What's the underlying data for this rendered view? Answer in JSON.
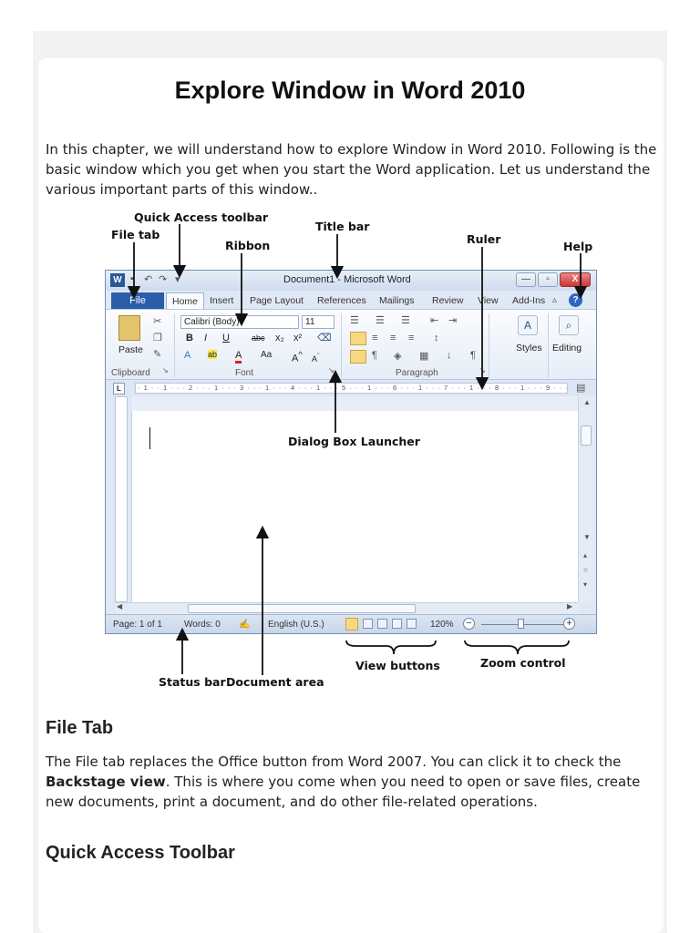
{
  "article": {
    "title": "Explore Window in Word 2010",
    "intro": "In this chapter, we will understand how to explore Window in Word 2010. Following is the basic window which you get when you start the Word application. Let us understand the various important parts of this window..",
    "sections": [
      {
        "heading": "File Tab",
        "text_before": "The File tab replaces the Office button from Word 2007. You can click it to check the ",
        "bold": "Backstage view",
        "text_after": ". This is where you come when you need to open or save files, create new documents, print a document, and do other file-related operations."
      },
      {
        "heading": "Quick Access Toolbar"
      }
    ]
  },
  "figure": {
    "callouts": {
      "quick_access_toolbar": "Quick Access toolbar",
      "file_tab": "File tab",
      "ribbon": "Ribbon",
      "title_bar": "Title bar",
      "ruler": "Ruler",
      "help": "Help",
      "dialog_box_launcher": "Dialog Box Launcher",
      "view_buttons": "View buttons",
      "zoom_control": "Zoom control",
      "status_bar": "Status bar",
      "document_area": "Document area"
    },
    "word_window": {
      "window_title": "Document1 - Microsoft Word",
      "app_icon_letter": "W",
      "file_tab": "File",
      "tabs": [
        "Home",
        "Insert",
        "Page Layout",
        "References",
        "Mailings",
        "Review",
        "View",
        "Add-Ins"
      ],
      "help_symbol": "?",
      "minimize": "—",
      "restore": "▫",
      "close": "X",
      "font_name": "Calibri (Body)",
      "font_size": "11",
      "paste_label": "Paste",
      "groups": [
        "Clipboard",
        "Font",
        "Paragraph"
      ],
      "styles_label": "Styles",
      "editing_label": "Editing",
      "format_buttons": [
        "B",
        "I",
        "U",
        "abc",
        "x₂",
        "x²"
      ],
      "ruler_marks": "· 1 · · 1 · · · 2 · · · 1 · · · 3 · · · 1 · · · 4 · · · 1 · · · 5 · · · 1 · · · 6 · · · 1 · · · 7 · · · 1 · · · 8 · · · 1 · · · 9 · · · 1 · · · 10 · · · 1",
      "status": {
        "page": "Page: 1 of 1",
        "words": "Words: 0",
        "language": "English (U.S.)",
        "zoom": "120%"
      }
    }
  }
}
